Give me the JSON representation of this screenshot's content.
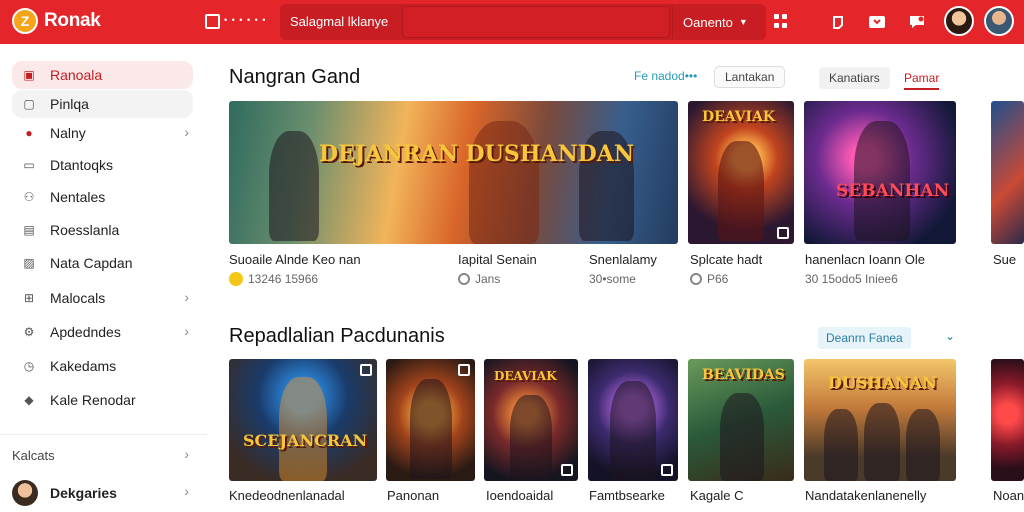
{
  "app": {
    "name": "Ronak",
    "logo_glyph": "Z"
  },
  "header": {
    "dots_label": "• • • • • •",
    "search_label": "Salagmal lklanye",
    "search_placeholder": "",
    "select_value": "Oanento",
    "colors": {
      "bar": "#e4262b",
      "accent": "#c41d22"
    }
  },
  "sidebar": {
    "items": [
      {
        "label": "Ranoala",
        "icon": "home-icon"
      },
      {
        "label": "Pinlqa",
        "icon": "square-icon"
      },
      {
        "label": "Nalny",
        "icon": "record-icon"
      },
      {
        "label": "Dtantoqks",
        "icon": "monitor-icon"
      },
      {
        "label": "Nentales",
        "icon": "people-icon"
      },
      {
        "label": "Roesslanla",
        "icon": "document-icon"
      },
      {
        "label": "Nata Capdan",
        "icon": "image-icon"
      },
      {
        "label": "Malocals",
        "icon": "grid-icon"
      },
      {
        "label": "Apdedndes",
        "icon": "settings-icon"
      },
      {
        "label": "Kakedams",
        "icon": "clock-icon"
      },
      {
        "label": "Kale Renodar",
        "icon": "user-icon"
      }
    ],
    "footer_label": "Kalcats",
    "user_name": "Dekgaries"
  },
  "section1": {
    "title": "Nangran Gand",
    "link": "Fe nadod•••",
    "pill": "Lantakan",
    "tab_gray": "Kanatiars",
    "tab_active": "Pamar",
    "cards": [
      {
        "label": "DEJANRAN DUSHANDAN",
        "caption": "Suoaile Alnde Keo nan",
        "meta": "13246 15966"
      },
      {
        "label": "",
        "caption": "Iapital Senain",
        "meta": "Jans"
      },
      {
        "label": "",
        "caption": "Snenlalamy",
        "meta": "30•some"
      },
      {
        "label": "DEAVIAK",
        "caption": "Splcate hadt",
        "meta": "P66"
      },
      {
        "label": "SEBANHAN",
        "caption": "hanenlacn Ioann Ole",
        "meta": "30 15odo5 Iniee6"
      },
      {
        "label": "",
        "caption": "Sue",
        "meta": ""
      }
    ]
  },
  "section2": {
    "title": "Repadlalian Pacdunanis",
    "badge": "Deanrn Fanea",
    "cards": [
      {
        "label": "SCEJANCRAN",
        "caption": "Knedeodnenlanadal"
      },
      {
        "label": "",
        "caption": "Panonan"
      },
      {
        "label": "DEAVIAK",
        "caption": "Ioendoaidal"
      },
      {
        "label": "",
        "caption": "Famtbsearke"
      },
      {
        "label": "BEAVIDAS",
        "caption": "Kagale C"
      },
      {
        "label": "DUSHANAN",
        "caption": "Nandatakenlanenelly"
      },
      {
        "label": "",
        "caption": "Noan"
      }
    ]
  }
}
